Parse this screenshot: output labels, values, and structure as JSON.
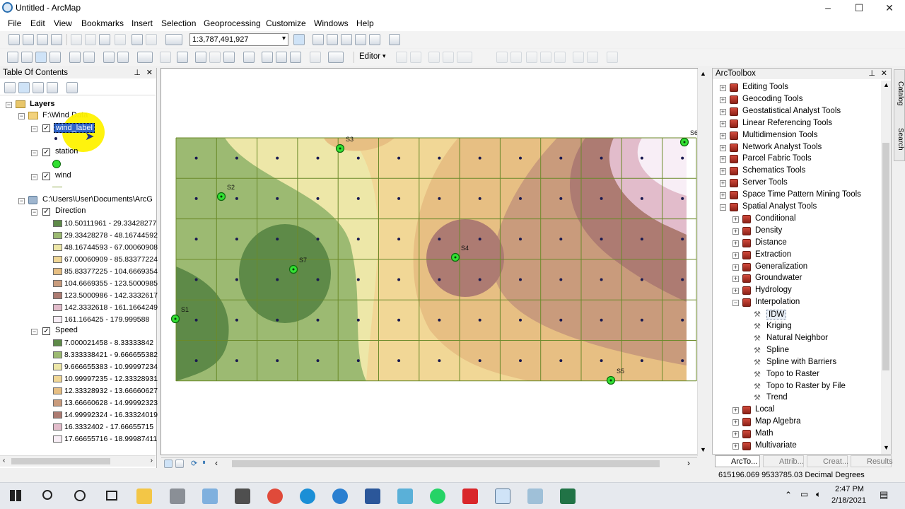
{
  "window": {
    "title": "Untitled - ArcMap",
    "controls": [
      "–",
      "☐",
      "✕"
    ]
  },
  "menu": [
    "File",
    "Edit",
    "View",
    "Bookmarks",
    "Insert",
    "Selection",
    "Geoprocessing",
    "Customize",
    "Windows",
    "Help"
  ],
  "toolbar": {
    "scale": "1:3,787,491,927",
    "editor_label": "Editor"
  },
  "toc": {
    "title": "Table Of Contents",
    "layers_root": "Layers",
    "folder1": "F:\\Wind Data",
    "layer_wind_label": "wind_label",
    "layer_station": "station",
    "layer_wind": "wind",
    "folder2": "C:\\Users\\User\\Documents\\ArcG",
    "direction": {
      "name": "Direction",
      "classes": [
        {
          "label": "10.50111961 - 29.33428277",
          "color": "#5e8a48"
        },
        {
          "label": "29.33428278 - 48.16744592",
          "color": "#9cba72"
        },
        {
          "label": "48.16744593 - 67.00060908",
          "color": "#ede7a8"
        },
        {
          "label": "67.00060909 - 85.83377224",
          "color": "#f1d796"
        },
        {
          "label": "85.83377225 - 104.6669354",
          "color": "#e7bf83"
        },
        {
          "label": "104.6669355 - 123.5000985",
          "color": "#c99b7c"
        },
        {
          "label": "123.5000986 - 142.3332617",
          "color": "#ad7b72"
        },
        {
          "label": "142.3332618 - 161.1664249",
          "color": "#e2bccb"
        },
        {
          "label": "161.166425 - 179.999588",
          "color": "#f8eef6"
        }
      ]
    },
    "speed": {
      "name": "Speed",
      "classes": [
        {
          "label": "7.000021458 - 8.33333842",
          "color": "#5e8a48"
        },
        {
          "label": "8.333338421 - 9.666655382",
          "color": "#9cba72"
        },
        {
          "label": "9.666655383 - 10.99997234",
          "color": "#ede7a8"
        },
        {
          "label": "10.99997235 - 12.33328931",
          "color": "#f1d796"
        },
        {
          "label": "12.33328932 - 13.66660627",
          "color": "#e7bf83"
        },
        {
          "label": "13.66660628 - 14.99992323",
          "color": "#c99b7c"
        },
        {
          "label": "14.99992324 - 16.33324019",
          "color": "#ad7b72"
        },
        {
          "label": "16.3332402 - 17.66655715",
          "color": "#e2bccb"
        },
        {
          "label": "17.66655716 - 18.99987411",
          "color": "#f8eef6"
        }
      ]
    }
  },
  "map": {
    "stations": [
      "S1",
      "S2",
      "S3",
      "S4",
      "S5",
      "S6",
      "S7"
    ]
  },
  "toolbox": {
    "title": "ArcToolbox",
    "top_level": [
      "Editing Tools",
      "Geocoding Tools",
      "Geostatistical Analyst Tools",
      "Linear Referencing Tools",
      "Multidimension Tools",
      "Network Analyst Tools",
      "Parcel Fabric Tools",
      "Schematics Tools",
      "Server Tools",
      "Space Time Pattern Mining Tools",
      "Spatial Analyst Tools"
    ],
    "spatial_children_a": [
      "Conditional",
      "Density",
      "Distance",
      "Extraction",
      "Generalization",
      "Groundwater",
      "Hydrology",
      "Interpolation"
    ],
    "interpolation_tools": [
      "IDW",
      "Kriging",
      "Natural Neighbor",
      "Spline",
      "Spline with Barriers",
      "Topo to Raster",
      "Topo to Raster by File",
      "Trend"
    ],
    "spatial_children_b": [
      "Local",
      "Map Algebra",
      "Math",
      "Multivariate"
    ],
    "tabs": [
      "ArcTo...",
      "Attrib...",
      "Creat...",
      "Results"
    ],
    "side_tabs": [
      "Catalog",
      "Search"
    ]
  },
  "status": {
    "coords": "615196.069  9533785.03 Decimal Degrees"
  },
  "taskbar": {
    "time": "2:47 PM",
    "date": "2/18/2021"
  }
}
